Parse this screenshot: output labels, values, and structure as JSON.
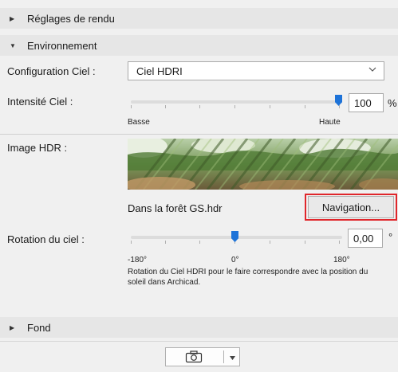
{
  "sections": {
    "render_settings": {
      "label": "Réglages de rendu",
      "icon": "triangle-right-icon"
    },
    "environment": {
      "label": "Environnement",
      "icon": "triangle-down-icon"
    },
    "background": {
      "label": "Fond",
      "icon": "triangle-right-icon"
    }
  },
  "sky_config": {
    "label": "Configuration Ciel :",
    "value": "Ciel HDRI"
  },
  "sky_intensity": {
    "label": "Intensité Ciel :",
    "value": "100",
    "unit": "%",
    "min_label": "Basse",
    "max_label": "Haute",
    "level_percent": 100
  },
  "hdr_image": {
    "label": "Image HDR :",
    "filename": "Dans la forêt GS.hdr",
    "browse_label": "Navigation..."
  },
  "sky_rotation": {
    "label": "Rotation du ciel :",
    "value": "0,00",
    "unit": "°",
    "tick_min": "-180°",
    "tick_mid": "0°",
    "tick_max": "180°",
    "level_degrees": 0,
    "help_line1": "Rotation du Ciel HDRI pour le faire correspondre avec la position du",
    "help_line2": "soleil dans Archicad."
  },
  "colors": {
    "accent": "#1e73d8",
    "highlight": "#e0262b"
  },
  "toolbar": {
    "camera_icon": "camera-icon",
    "dropdown_icon": "chevron-down-icon"
  }
}
